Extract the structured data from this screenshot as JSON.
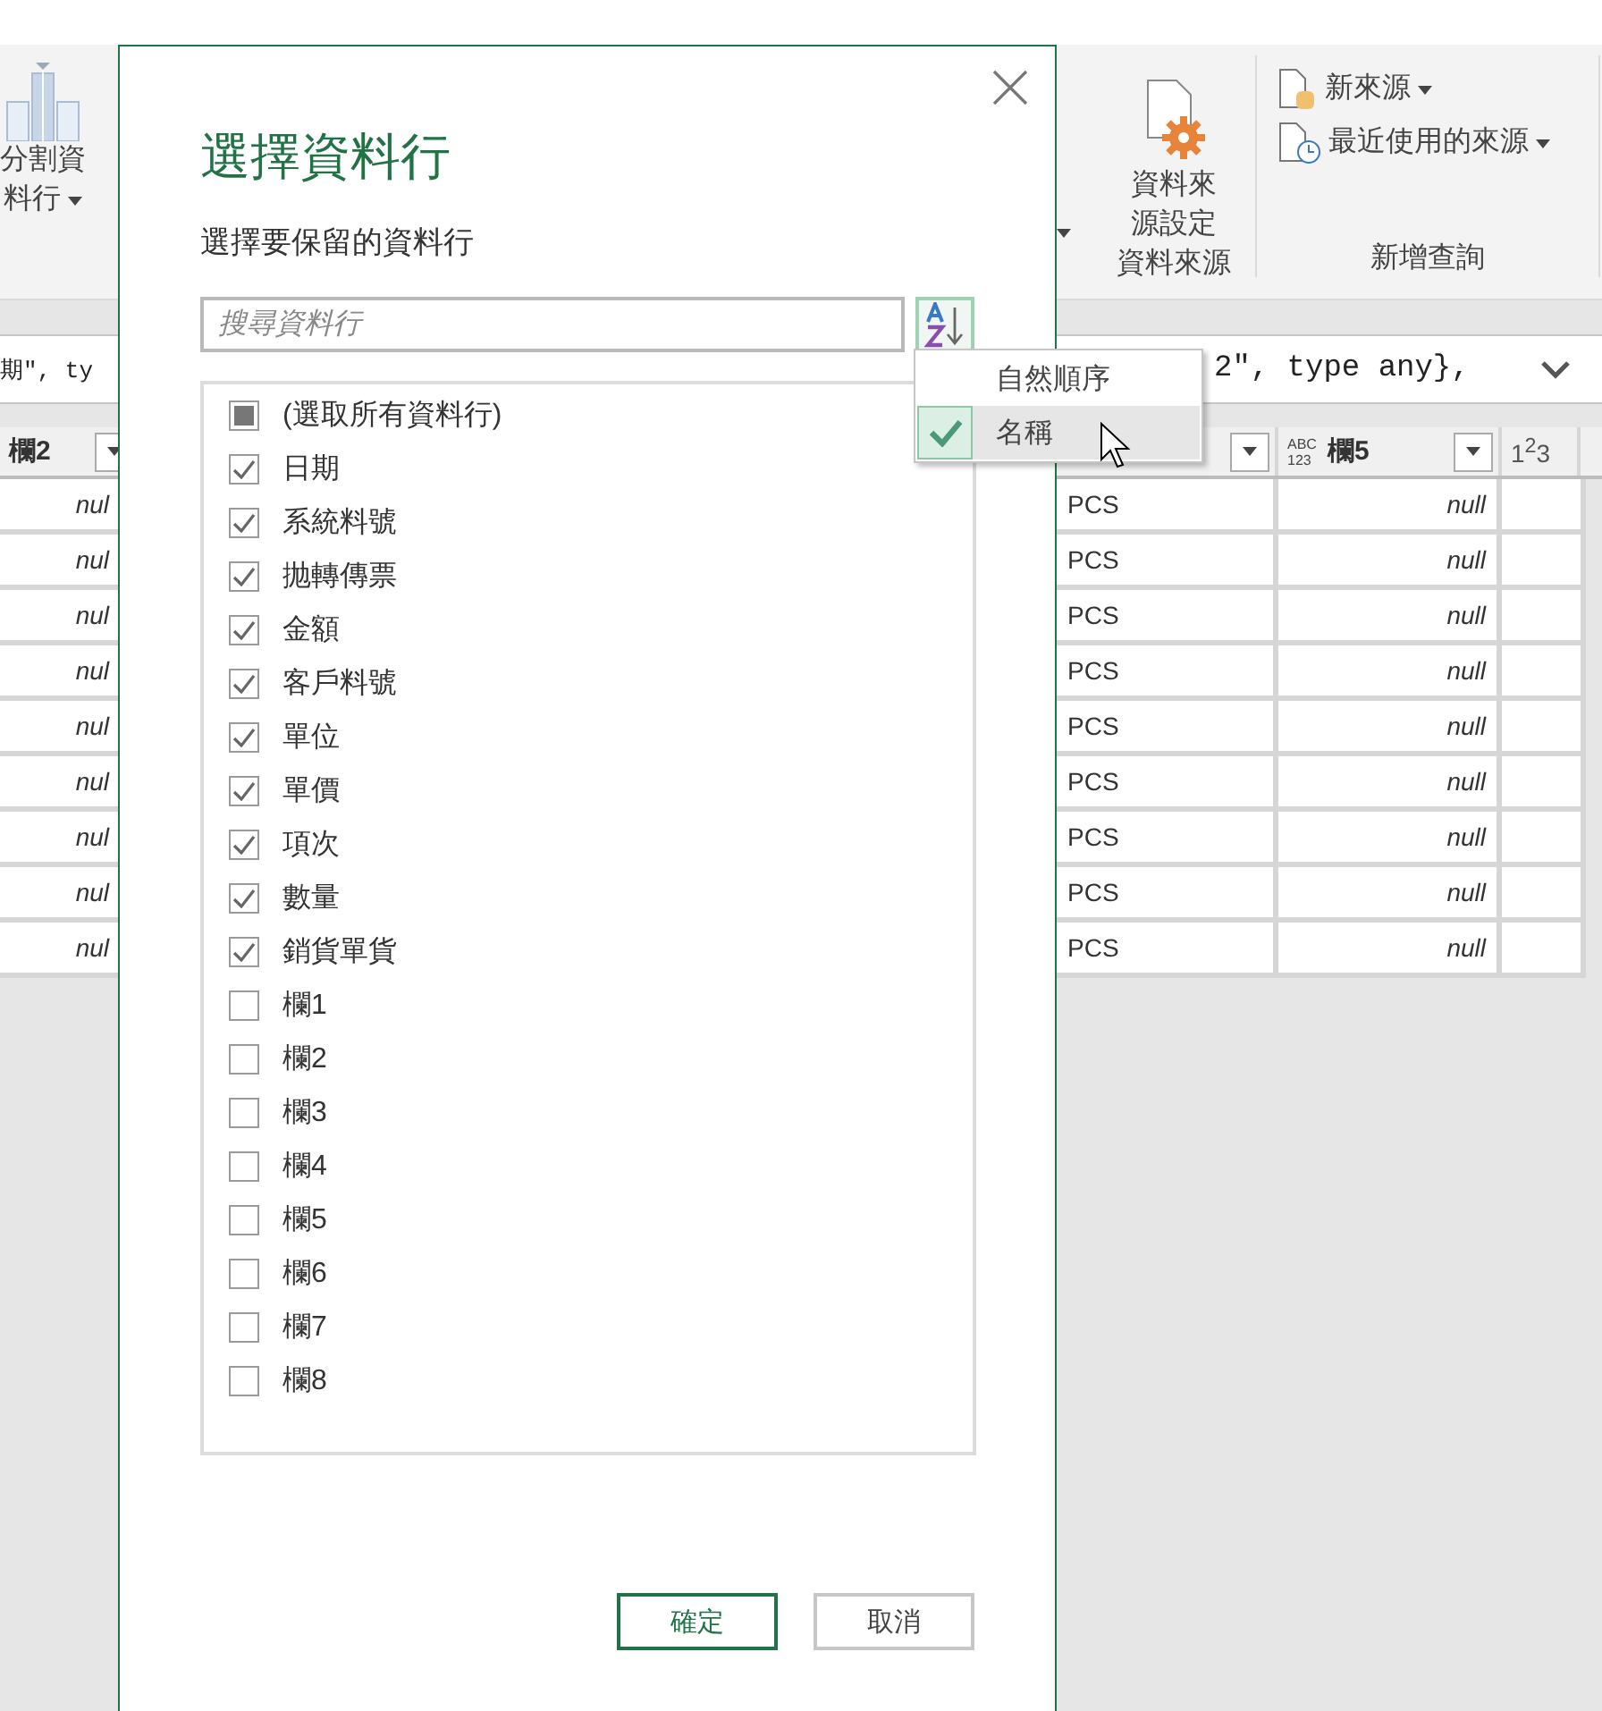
{
  "ribbon": {
    "left_button": {
      "label": [
        "分割資",
        "料行"
      ],
      "dropdown": true
    },
    "groups": [
      {
        "label": "資料來源",
        "buttons": [
          {
            "kind": "large",
            "label": [
              "資料來",
              "源設定"
            ],
            "dropdown": false
          }
        ]
      },
      {
        "label": "新增查詢",
        "buttons": [
          {
            "kind": "small",
            "label": [
              "新來源"
            ],
            "dropdown": true
          },
          {
            "kind": "small",
            "label": [
              "最近使用的來源"
            ],
            "dropdown": true
          }
        ]
      }
    ]
  },
  "formula_bar": {
    "left_text": "期\", ty",
    "right_text": "2\", type any},"
  },
  "table": {
    "left_header": "欄2",
    "columns": [
      {},
      {
        "name": "欄5",
        "type_lines": [
          "ABC",
          "123"
        ]
      },
      {
        "type_mark": "1$^{2}$3"
      }
    ],
    "rows": [
      {
        "cells": [
          "nul",
          "PCS",
          "null"
        ]
      },
      {
        "cells": [
          "nul",
          "PCS",
          "null"
        ]
      },
      {
        "cells": [
          "nul",
          "PCS",
          "null"
        ]
      },
      {
        "cells": [
          "nul",
          "PCS",
          "null"
        ]
      },
      {
        "cells": [
          "nul",
          "PCS",
          "null"
        ]
      },
      {
        "cells": [
          "nul",
          "PCS",
          "null"
        ]
      },
      {
        "cells": [
          "nul",
          "PCS",
          "null"
        ]
      },
      {
        "cells": [
          "nul",
          "PCS",
          "null"
        ]
      },
      {
        "cells": [
          "nul",
          "PCS",
          "null"
        ]
      }
    ]
  },
  "dialog": {
    "title": "選擇資料行",
    "subtitle": "選擇要保留的資料行",
    "search": {
      "placeholder": "搜尋資料行"
    },
    "select_all": {
      "label": "(選取所有資料行)",
      "checked": false,
      "indeterminate": true
    },
    "columns": [
      {
        "label": "日期",
        "checked": true
      },
      {
        "label": "系統料號",
        "checked": true
      },
      {
        "label": "抛轉傳票",
        "checked": true
      },
      {
        "label": "金額",
        "checked": true
      },
      {
        "label": "客戶料號",
        "checked": true
      },
      {
        "label": "單位",
        "checked": true
      },
      {
        "label": "單價",
        "checked": true
      },
      {
        "label": "項次",
        "checked": true
      },
      {
        "label": "數量",
        "checked": true
      },
      {
        "label": "銷貨單貨",
        "checked": true
      },
      {
        "label": "欄1",
        "checked": false
      },
      {
        "label": "欄2",
        "checked": false
      },
      {
        "label": "欄3",
        "checked": false
      },
      {
        "label": "欄4",
        "checked": false
      },
      {
        "label": "欄5",
        "checked": false
      },
      {
        "label": "欄6",
        "checked": false
      },
      {
        "label": "欄7",
        "checked": false
      },
      {
        "label": "欄8",
        "checked": false
      }
    ],
    "buttons": [
      {
        "label": "確定",
        "kind": "primary"
      },
      {
        "label": "取消",
        "kind": "secondary"
      }
    ]
  },
  "sort_menu": {
    "items": [
      {
        "label": "自然順序",
        "selected": false
      },
      {
        "label": "名稱",
        "selected": true
      }
    ]
  }
}
